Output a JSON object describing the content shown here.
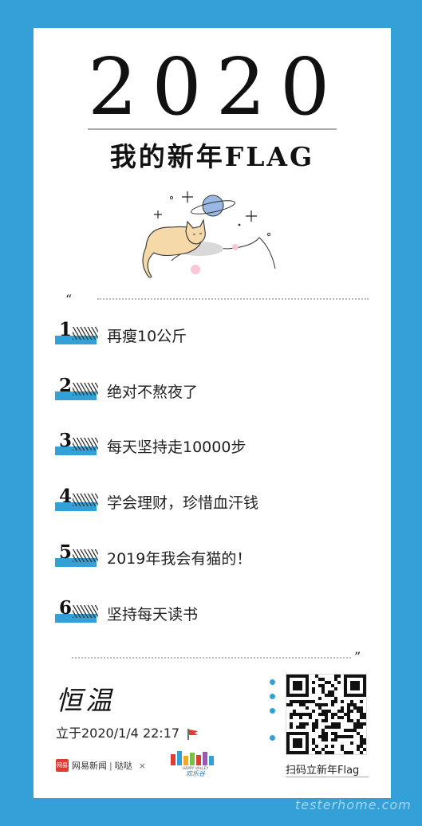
{
  "poster": {
    "year": "2020",
    "subtitle": "我的新年FLAG",
    "quote_open": "“",
    "quote_close": "”"
  },
  "flags": [
    {
      "num": "1",
      "text": "再瘦10公斤"
    },
    {
      "num": "2",
      "text": "绝对不熬夜了"
    },
    {
      "num": "3",
      "text": "每天坚持走10000步"
    },
    {
      "num": "4",
      "text": "学会理财，珍惜血汗钱"
    },
    {
      "num": "5",
      "text": "2019年我会有猫的！"
    },
    {
      "num": "6",
      "text": "坚持每天读书"
    }
  ],
  "footer": {
    "signature": "恒温",
    "date_text": "立于2020/1/4 22:17",
    "brand_badge": "网易",
    "brand_name": "网易新闻",
    "brand_divider": "|",
    "brand_partner": "哒哒",
    "brand_x": "×",
    "happy_valley_sub": "HAPPY VALLEY",
    "happy_valley_name": "欢乐谷",
    "qr_label": "扫码立新年Flag"
  },
  "watermark": "testerhome.com",
  "colors": {
    "background": "#33a0d8",
    "card": "#ffffff",
    "accent": "#33a0d8",
    "flag_red": "#e03c31"
  },
  "icons": [
    "cat-illustration",
    "planet-icon",
    "sparkle-icon",
    "red-flag-icon",
    "qr-code",
    "happy-valley-logo"
  ]
}
